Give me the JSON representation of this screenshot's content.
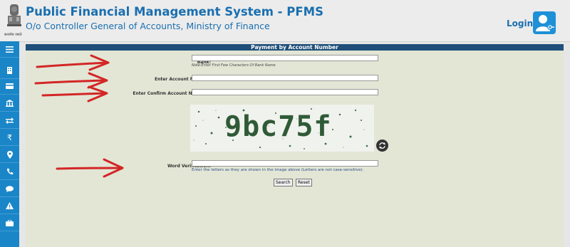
{
  "header": {
    "title": "Public Financial Management System - PFMS",
    "subtitle": "O/o Controller General of Accounts, Ministry of Finance",
    "emblem_caption": "सत्यमेव जयते",
    "login_label": "Login"
  },
  "sidebar": {
    "items": [
      "menu-icon",
      "building-icon",
      "card-icon",
      "bank-icon",
      "transfer-icon",
      "rupee-icon",
      "location-icon",
      "phone-icon",
      "chat-icon",
      "warning-icon",
      "briefcase-icon"
    ]
  },
  "form": {
    "title": "Payment by Account Number",
    "bank_label": "Bank:",
    "bank_note": "Note:Enter First Few Characters Of Bank Name",
    "account_label": "Enter Account Number:",
    "confirm_label": "Enter Confirm Account Number :",
    "captcha_text": "9bc75f",
    "word_label": "Word Verification:",
    "word_hint": "Enter the letters as they are shown in the image above (Letters are not case-sensitive).",
    "search_label": "Search",
    "reset_label": "Reset"
  },
  "colors": {
    "title_blue": "#1a6fb0",
    "sidebar_blue": "#1a86c8",
    "panel_header": "#1e4e79",
    "panel_bg": "#e3e6d5",
    "arrow_red": "#d32626"
  }
}
